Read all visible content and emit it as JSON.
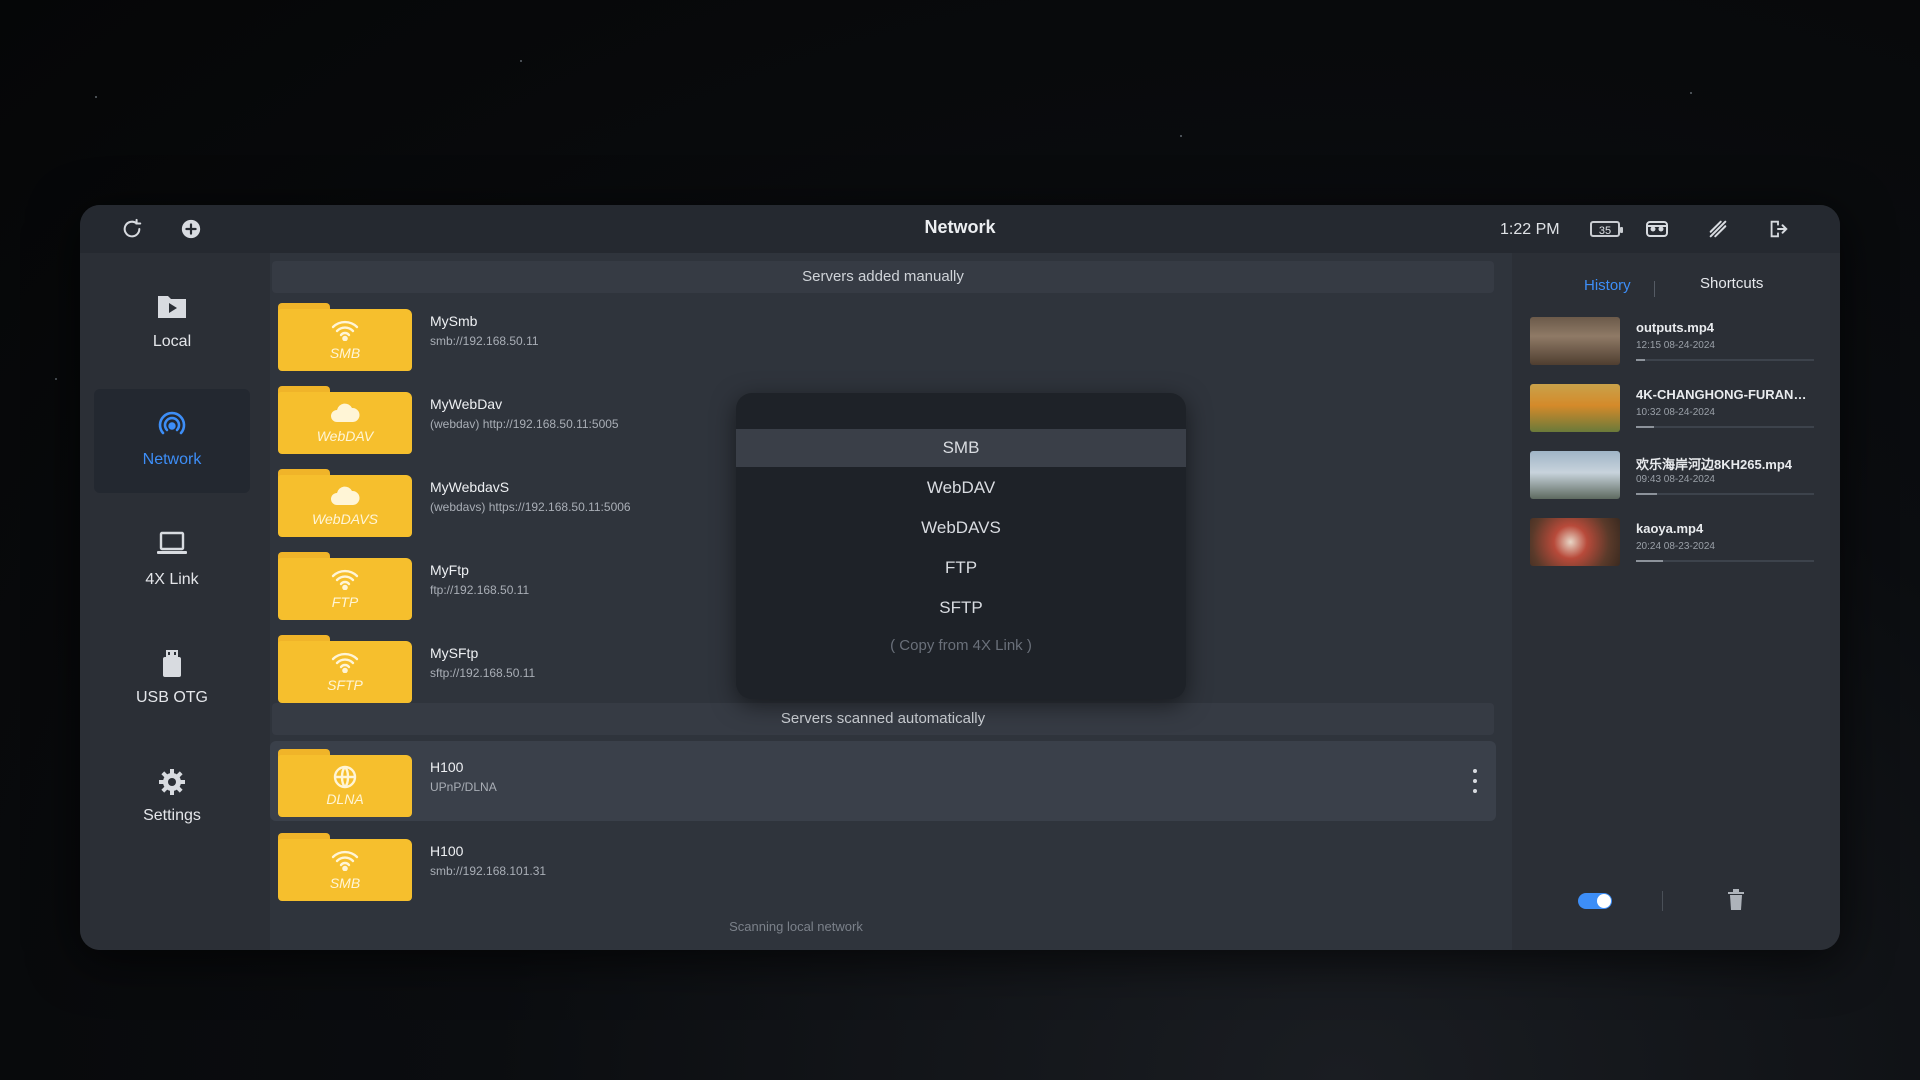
{
  "topbar": {
    "title": "Network",
    "time": "1:22 PM",
    "battery": "35"
  },
  "sidebar": {
    "items": [
      {
        "label": "Local",
        "icon": "play-folder-icon"
      },
      {
        "label": "Network",
        "icon": "network-signal-icon",
        "active": true
      },
      {
        "label": "4X Link",
        "icon": "laptop-icon"
      },
      {
        "label": "USB OTG",
        "icon": "usb-drive-icon"
      },
      {
        "label": "Settings",
        "icon": "gear-icon"
      }
    ]
  },
  "main": {
    "manual_header": "Servers added manually",
    "manual_servers": [
      {
        "type": "SMB",
        "name": "MySmb",
        "address": "smb://192.168.50.11"
      },
      {
        "type": "WebDAV",
        "name": "MyWebDav",
        "address": "(webdav) http://192.168.50.11:5005"
      },
      {
        "type": "WebDAVS",
        "name": "MyWebdavS",
        "address": "(webdavs) https://192.168.50.11:5006"
      },
      {
        "type": "FTP",
        "name": "MyFtp",
        "address": "ftp://192.168.50.11"
      },
      {
        "type": "SFTP",
        "name": "MySFtp",
        "address": "sftp://192.168.50.11"
      }
    ],
    "auto_header": "Servers scanned automatically",
    "auto_servers": [
      {
        "type": "DLNA",
        "name": "H100",
        "address": "UPnP/DLNA"
      },
      {
        "type": "SMB",
        "name": "H100",
        "address": "smb://192.168.101.31"
      }
    ],
    "status": "Scanning local network"
  },
  "popup": {
    "options": [
      "SMB",
      "WebDAV",
      "WebDAVS",
      "FTP",
      "SFTP",
      "( Copy from 4X Link )"
    ],
    "selected": "SMB"
  },
  "rightpanel": {
    "tabs": [
      "History",
      "Shortcuts"
    ],
    "active_tab": "History",
    "history": [
      {
        "name": "outputs.mp4",
        "time": "12:15 08-24-2024",
        "progress": 0.05
      },
      {
        "name": "4K-CHANGHONG-FURANO-...",
        "time": "10:32 08-24-2024",
        "progress": 0.1
      },
      {
        "name": "欢乐海岸河边8KH265.mp4",
        "time": "09:43 08-24-2024",
        "progress": 0.12
      },
      {
        "name": "kaoya.mp4",
        "time": "20:24 08-23-2024",
        "progress": 0.15
      }
    ]
  },
  "colors": {
    "accent": "#3d8ef7",
    "folder": "#f6bf2d",
    "panel": "#2b2f36"
  }
}
